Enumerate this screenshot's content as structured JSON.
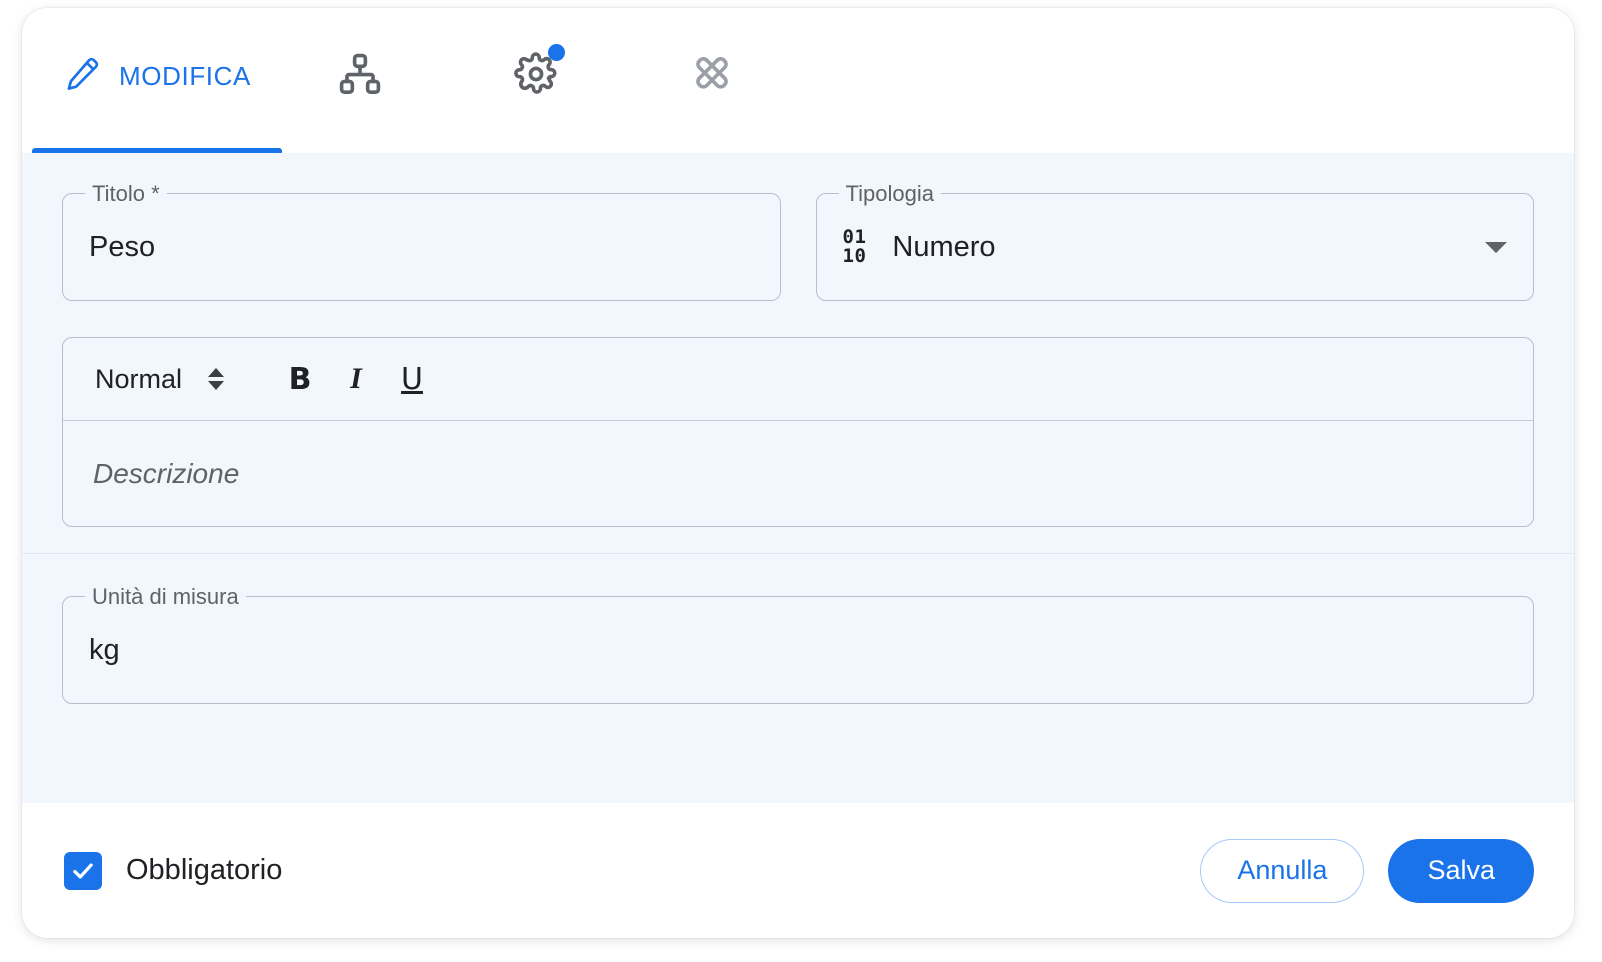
{
  "tabs": [
    {
      "id": "modifica",
      "label": "MODIFICA",
      "icon": "pencil-icon",
      "active": true,
      "badge": false
    },
    {
      "id": "struttura",
      "label": "",
      "icon": "account-tree-icon",
      "active": false,
      "badge": false
    },
    {
      "id": "impostazioni",
      "label": "",
      "icon": "gear-icon",
      "active": false,
      "badge": true
    },
    {
      "id": "design",
      "label": "",
      "icon": "design-services-icon",
      "active": false,
      "badge": false
    }
  ],
  "form": {
    "titolo": {
      "legend": "Titolo *",
      "value": "Peso"
    },
    "tipologia": {
      "legend": "Tipologia",
      "value": "Numero",
      "icon": "binary-icon",
      "icon_top": "01",
      "icon_bottom": "10"
    },
    "editor": {
      "style_label": "Normal",
      "bold_label": "B",
      "italic_label": "I",
      "underline_label": "U",
      "placeholder": "Descrizione"
    },
    "unita": {
      "legend": "Unità di misura",
      "value": "kg"
    }
  },
  "footer": {
    "required_label": "Obbligatorio",
    "required_checked": true,
    "cancel_label": "Annulla",
    "save_label": "Salva"
  },
  "colors": {
    "accent": "#1a73e8",
    "form_background": "#f2f6fd",
    "panel_background": "#ffffff",
    "field_border": "#b9bfc9",
    "text_primary": "#202124",
    "text_secondary": "#5f6368"
  }
}
